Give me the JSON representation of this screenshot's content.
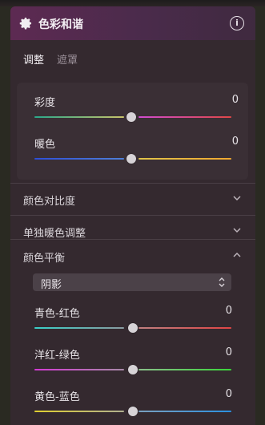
{
  "header": {
    "title": "色彩和谐",
    "gear_icon": "gear-icon",
    "info_icon": "info-icon",
    "info_glyph": "i"
  },
  "tabs": [
    {
      "label": "调整",
      "active": true
    },
    {
      "label": "遮罩",
      "active": false
    }
  ],
  "harmony_sliders": [
    {
      "label": "彩度",
      "value": "0",
      "colors": [
        "#2aa88a",
        "#c9c36a",
        "#d04cd0",
        "#e04747"
      ]
    },
    {
      "label": "暖色",
      "value": "0",
      "colors": [
        "#2e4fd6",
        "#4f7fd6",
        "#e0c34a",
        "#f0a830"
      ]
    }
  ],
  "sections": {
    "color_contrast": {
      "label": "颜色对比度",
      "expanded": false
    },
    "warm_adjust": {
      "label": "单独暖色调整",
      "expanded": false
    },
    "color_balance": {
      "label": "颜色平衡",
      "expanded": true
    }
  },
  "balance": {
    "tone_select": {
      "value": "阴影"
    },
    "sliders": [
      {
        "label": "青色-红色",
        "value": "0",
        "colors": [
          "#39d0c8",
          "#8a9aa0",
          "#c08080",
          "#e04545"
        ]
      },
      {
        "label": "洋红-绿色",
        "value": "0",
        "colors": [
          "#d43ad4",
          "#a88aa8",
          "#8ac08a",
          "#3ad43a"
        ]
      },
      {
        "label": "黄色-蓝色",
        "value": "0",
        "colors": [
          "#e0d030",
          "#b0b090",
          "#7aa0c0",
          "#2a90e0"
        ]
      }
    ]
  }
}
